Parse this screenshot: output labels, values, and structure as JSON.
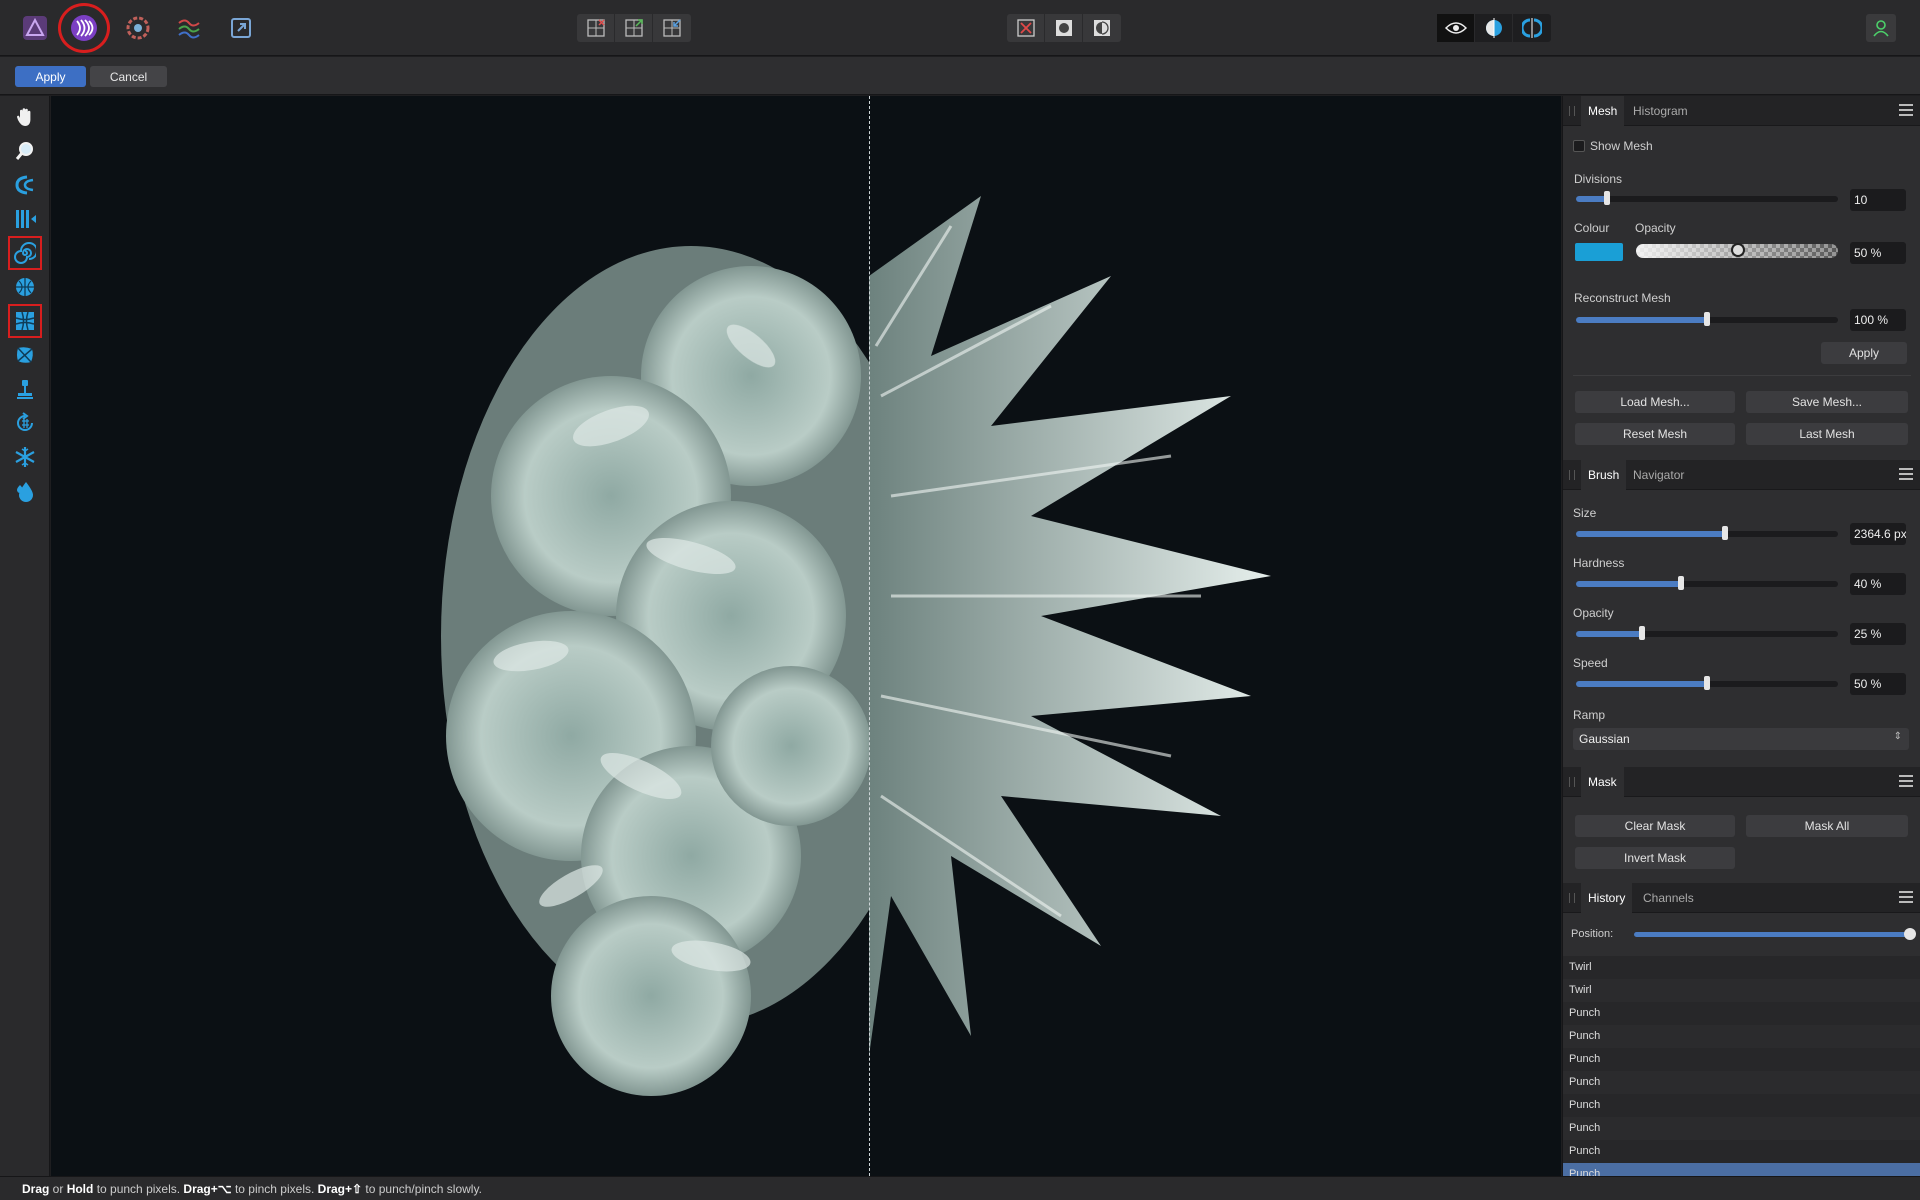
{
  "topbar": {
    "left_icons": [
      "affinity-photo-logo-icon",
      "liquify-persona-icon",
      "develop-persona-icon",
      "tone-mapping-persona-icon",
      "export-persona-icon"
    ],
    "mesh_group": [
      "mesh-clamp-icon",
      "mesh-pin-icon",
      "mesh-unpin-icon"
    ],
    "view_group": [
      "hide-mesh-icon",
      "show-mask-icon",
      "mask-invert-icon"
    ],
    "compare_group": [
      "preview-eye-icon",
      "split-view-icon",
      "mirror-view-icon"
    ],
    "account_icon": "user-account-icon"
  },
  "contextbar": {
    "apply_label": "Apply",
    "cancel_label": "Cancel"
  },
  "tools": [
    "hand-tool-icon",
    "zoom-tool-icon",
    "push-forward-tool-icon",
    "push-left-tool-icon",
    "twirl-tool-icon",
    "pinch-punch-tool-icon",
    "mesh-clamp-tool-icon",
    "turbulence-tool-icon",
    "reconstruct-tool-icon",
    "freeze-pin-tool-icon",
    "freeze-tool-icon",
    "thaw-tool-icon"
  ],
  "mesh_panel": {
    "tabs": [
      "Mesh",
      "Histogram"
    ],
    "show_mesh": "Show Mesh",
    "divisions_label": "Divisions",
    "divisions_value": "10",
    "divisions_level": 0.12,
    "colour_label": "Colour",
    "opacity_label": "Opacity",
    "opacity_value": "50 %",
    "colour": "#1a9fd6",
    "reconstruct_label": "Reconstruct Mesh",
    "reconstruct_value": "100 %",
    "reconstruct_level": 0.5,
    "apply_label": "Apply",
    "load_mesh": "Load Mesh...",
    "save_mesh": "Save Mesh...",
    "reset_mesh": "Reset Mesh",
    "last_mesh": "Last Mesh"
  },
  "brush_panel": {
    "tabs": [
      "Brush",
      "Navigator"
    ],
    "size_label": "Size",
    "size_value": "2364.6 px",
    "size_level": 0.57,
    "hardness_label": "Hardness",
    "hardness_value": "40 %",
    "hardness_level": 0.4,
    "opacity_label": "Opacity",
    "opacity_value": "25 %",
    "opacity_level": 0.25,
    "speed_label": "Speed",
    "speed_value": "50 %",
    "speed_level": 0.5,
    "ramp_label": "Ramp",
    "ramp_value": "Gaussian"
  },
  "mask_panel": {
    "tabs": [
      "Mask"
    ],
    "clear_mask": "Clear Mask",
    "mask_all": "Mask All",
    "invert_mask": "Invert Mask"
  },
  "history_panel": {
    "tabs": [
      "History",
      "Channels"
    ],
    "position_label": "Position:",
    "position_level": 1.0,
    "items": [
      "Twirl",
      "Twirl",
      "Punch",
      "Punch",
      "Punch",
      "Punch",
      "Punch",
      "Punch",
      "Punch",
      "Punch"
    ],
    "selected_index": 9
  },
  "status": {
    "drag": "Drag",
    "or": " or ",
    "hold": "Hold",
    "t1": " to punch pixels. ",
    "drag_alt": "Drag+⌥",
    "t2": " to pinch pixels. ",
    "drag_shift": "Drag+⇧",
    "t3": " to punch/pinch slowly."
  },
  "colors": {
    "accent": "#4b7cc2",
    "selection_ring": "#d81e1e",
    "history_selected": "#4b6ea3"
  }
}
